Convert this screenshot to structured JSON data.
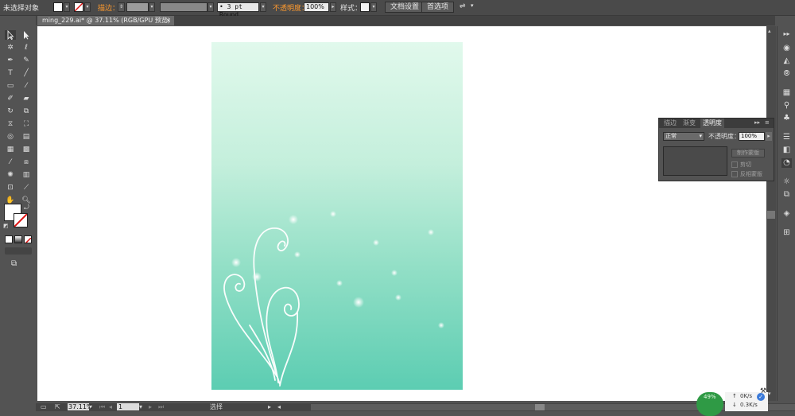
{
  "control": {
    "selection_label": "未选择对象",
    "stroke_label": "描边：",
    "brush_label": "3 pt Round",
    "opacity_label": "不透明度：",
    "opacity_value": "100%",
    "style_label": "样式：",
    "doc_setup_button": "文档设置",
    "prefs_button": "首选项"
  },
  "document": {
    "tab_title": "ming_229.ai* @ 37.11% (RGB/GPU 预览)",
    "close_glyph": "×"
  },
  "panel": {
    "tabs": [
      "描边",
      "渐变",
      "透明度"
    ],
    "blend_mode": "正常",
    "opacity_label": "不透明度：",
    "opacity_value": "100%",
    "make_mask_button": "制作蒙版",
    "clip_label": "剪切",
    "invert_label": "反相蒙版"
  },
  "status": {
    "zoom": "37.11%",
    "page": "1",
    "tool": "选择"
  },
  "net": {
    "percent": "49%",
    "up": "0K/s",
    "down": "0.3K/s"
  },
  "colors": {
    "accent_orange": "#ff9a2e",
    "ui_dark": "#535353",
    "gradient_top": "#e1f9ec",
    "gradient_bottom": "#5ccdb2"
  }
}
